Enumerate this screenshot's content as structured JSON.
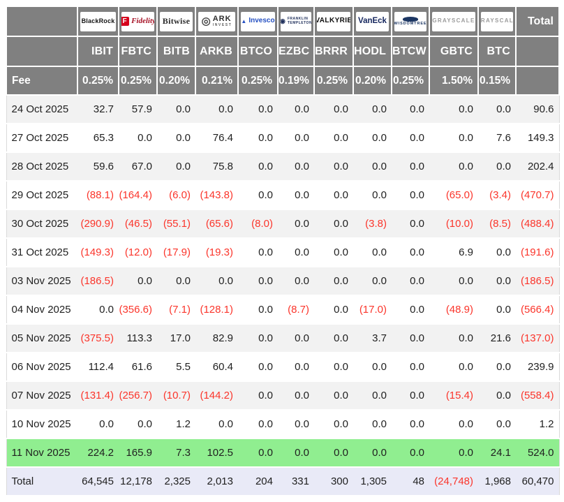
{
  "header": {
    "fee_row_label": "Fee",
    "total_column_label": "Total",
    "providers": [
      {
        "id": "blackrock",
        "name": "BlackRock"
      },
      {
        "id": "fidelity",
        "name": "Fidelity",
        "icon": "F"
      },
      {
        "id": "bitwise",
        "name": "Bitwise"
      },
      {
        "id": "ark-invest",
        "name": "ARK",
        "sub": "INVEST",
        "icon": "◎"
      },
      {
        "id": "invesco",
        "name": "Invesco",
        "icon": "▲"
      },
      {
        "id": "franklin-templeton",
        "name": "FRANKLIN",
        "sub": "TEMPLETON",
        "icon": "◉"
      },
      {
        "id": "valkyrie",
        "name": "VALKYRIE"
      },
      {
        "id": "vaneck",
        "name": "VanEck"
      },
      {
        "id": "wisdomtree",
        "name": "WISDOMTREE"
      },
      {
        "id": "grayscale",
        "name": "GRAYSCALE"
      },
      {
        "id": "grayscale-btc",
        "name": "GRAYSCALE"
      }
    ],
    "tickers": [
      "IBIT",
      "FBTC",
      "BITB",
      "ARKB",
      "BTCO",
      "EZBC",
      "BRRR",
      "HODL",
      "BTCW",
      "GBTC",
      "BTC"
    ],
    "fees": [
      "0.25%",
      "0.25%",
      "0.20%",
      "0.21%",
      "0.25%",
      "0.19%",
      "0.25%",
      "0.20%",
      "0.25%",
      "1.50%",
      "0.15%"
    ]
  },
  "chart_data": {
    "type": "table",
    "columns": [
      "IBIT",
      "FBTC",
      "BITB",
      "ARKB",
      "BTCO",
      "EZBC",
      "BRRR",
      "HODL",
      "BTCW",
      "GBTC",
      "BTC",
      "Total"
    ],
    "fees_percent": [
      0.25,
      0.25,
      0.2,
      0.21,
      0.25,
      0.19,
      0.25,
      0.2,
      0.25,
      1.5,
      0.15
    ],
    "rows": [
      {
        "date": "24 Oct 2025",
        "values": [
          32.7,
          57.9,
          0,
          0,
          0,
          0,
          0,
          0,
          0,
          0,
          0,
          90.6
        ]
      },
      {
        "date": "27 Oct 2025",
        "values": [
          65.3,
          0,
          0,
          76.4,
          0,
          0,
          0,
          0,
          0,
          0,
          7.6,
          149.3
        ]
      },
      {
        "date": "28 Oct 2025",
        "values": [
          59.6,
          67.0,
          0,
          75.8,
          0,
          0,
          0,
          0,
          0,
          0,
          0,
          202.4
        ]
      },
      {
        "date": "29 Oct 2025",
        "values": [
          -88.1,
          -164.4,
          -6.0,
          -143.8,
          0,
          0,
          0,
          0,
          0,
          -65.0,
          -3.4,
          -470.7
        ]
      },
      {
        "date": "30 Oct 2025",
        "values": [
          -290.9,
          -46.5,
          -55.1,
          -65.6,
          -8.0,
          0,
          0,
          -3.8,
          0,
          -10.0,
          -8.5,
          -488.4
        ]
      },
      {
        "date": "31 Oct 2025",
        "values": [
          -149.3,
          -12.0,
          -17.9,
          -19.3,
          0,
          0,
          0,
          0,
          0,
          6.9,
          0,
          -191.6
        ]
      },
      {
        "date": "03 Nov 2025",
        "values": [
          -186.5,
          0,
          0,
          0,
          0,
          0,
          0,
          0,
          0,
          0,
          0,
          -186.5
        ]
      },
      {
        "date": "04 Nov 2025",
        "values": [
          0,
          -356.6,
          -7.1,
          -128.1,
          0,
          -8.7,
          0,
          -17.0,
          0,
          -48.9,
          0,
          -566.4
        ]
      },
      {
        "date": "05 Nov 2025",
        "values": [
          -375.5,
          113.3,
          17.0,
          82.9,
          0,
          0,
          0,
          3.7,
          0,
          0,
          21.6,
          -137.0
        ]
      },
      {
        "date": "06 Nov 2025",
        "values": [
          112.4,
          61.6,
          5.5,
          60.4,
          0,
          0,
          0,
          0,
          0,
          0,
          0,
          239.9
        ]
      },
      {
        "date": "07 Nov 2025",
        "values": [
          -131.4,
          -256.7,
          -10.7,
          -144.2,
          0,
          0,
          0,
          0,
          0,
          -15.4,
          0,
          -558.4
        ]
      },
      {
        "date": "10 Nov 2025",
        "values": [
          0,
          0,
          1.2,
          0,
          0,
          0,
          0,
          0,
          0,
          0,
          0,
          1.2
        ]
      },
      {
        "date": "11 Nov 2025",
        "values": [
          224.2,
          165.9,
          7.3,
          102.5,
          0,
          0,
          0,
          0,
          0,
          0,
          24.1,
          524.0
        ],
        "highlight": true
      }
    ],
    "total_row": {
      "label": "Total",
      "values": [
        64545,
        12178,
        2325,
        2013,
        204,
        331,
        300,
        1305,
        48,
        -24748,
        1968,
        60470
      ]
    }
  },
  "colors": {
    "header_bg": "#808080",
    "header_text": "#ffffff",
    "row_bg": "#ffffff",
    "row_alt_bg": "#f2f2f2",
    "highlight_row_bg": "#90ee90",
    "total_row_bg": "#e9eaf7",
    "negative_text": "#fb352b",
    "text": "#1f1f1f"
  }
}
